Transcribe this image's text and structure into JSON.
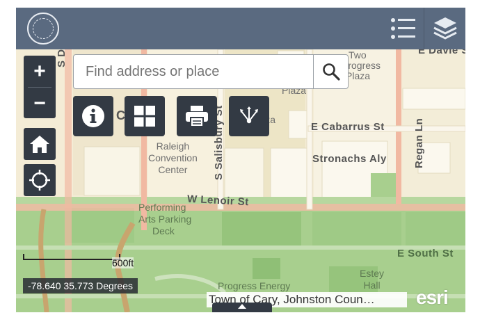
{
  "header": {
    "seal_icon": "nc-state-seal-icon",
    "legend_icon": "legend-list-icon",
    "layers_icon": "layers-stack-icon"
  },
  "map_controls": {
    "zoom_in": "+",
    "zoom_out": "−",
    "home_icon": "home-icon",
    "locate_icon": "crosshair-icon"
  },
  "search": {
    "placeholder": "Find address or place",
    "icon": "search-icon"
  },
  "toolbar": [
    {
      "name": "info",
      "icon": "info-icon"
    },
    {
      "name": "basemap",
      "icon": "grid-icon"
    },
    {
      "name": "print",
      "icon": "printer-icon"
    },
    {
      "name": "share",
      "icon": "share-icon"
    }
  ],
  "map_labels": {
    "two_progress_plaza_1": "Two",
    "two_progress_plaza_2": "Progress",
    "two_progress_plaza_3": "Plaza",
    "plaza": "Plaza",
    "davie_st": "E Davie S",
    "s_d": "S D",
    "city_plaza_1": "City",
    "city_plaza_2": "Plaza",
    "c_letter": "C",
    "s_salisbury_st": "S Salisbury St",
    "e_cabarrus_st": "E Cabarrus St",
    "regan_ln": "Regan Ln",
    "convention_center_1": "Raleigh",
    "convention_center_2": "Convention",
    "convention_center_3": "Center",
    "stronachs_aly": "Stronachs Aly",
    "w_lenoir_st": "W Lenoir St",
    "parking_deck_1": "Performing",
    "parking_deck_2": "Arts Parking",
    "parking_deck_3": "Deck",
    "e_south_st": "E South St",
    "estey_hall_1": "Estey",
    "estey_hall_2": "Hall",
    "progress_energy": "Progress Energy"
  },
  "scale": {
    "label": "600ft"
  },
  "coordinates": "-78.640 35.773 Degrees",
  "attribution": "Town of Cary, Johnston Coun…",
  "logo": "esri",
  "colors": {
    "header_bg": "#5a6a80",
    "control_bg": "#333a44",
    "park_green": "#a8cf8e",
    "road": "#f1b9a2"
  }
}
